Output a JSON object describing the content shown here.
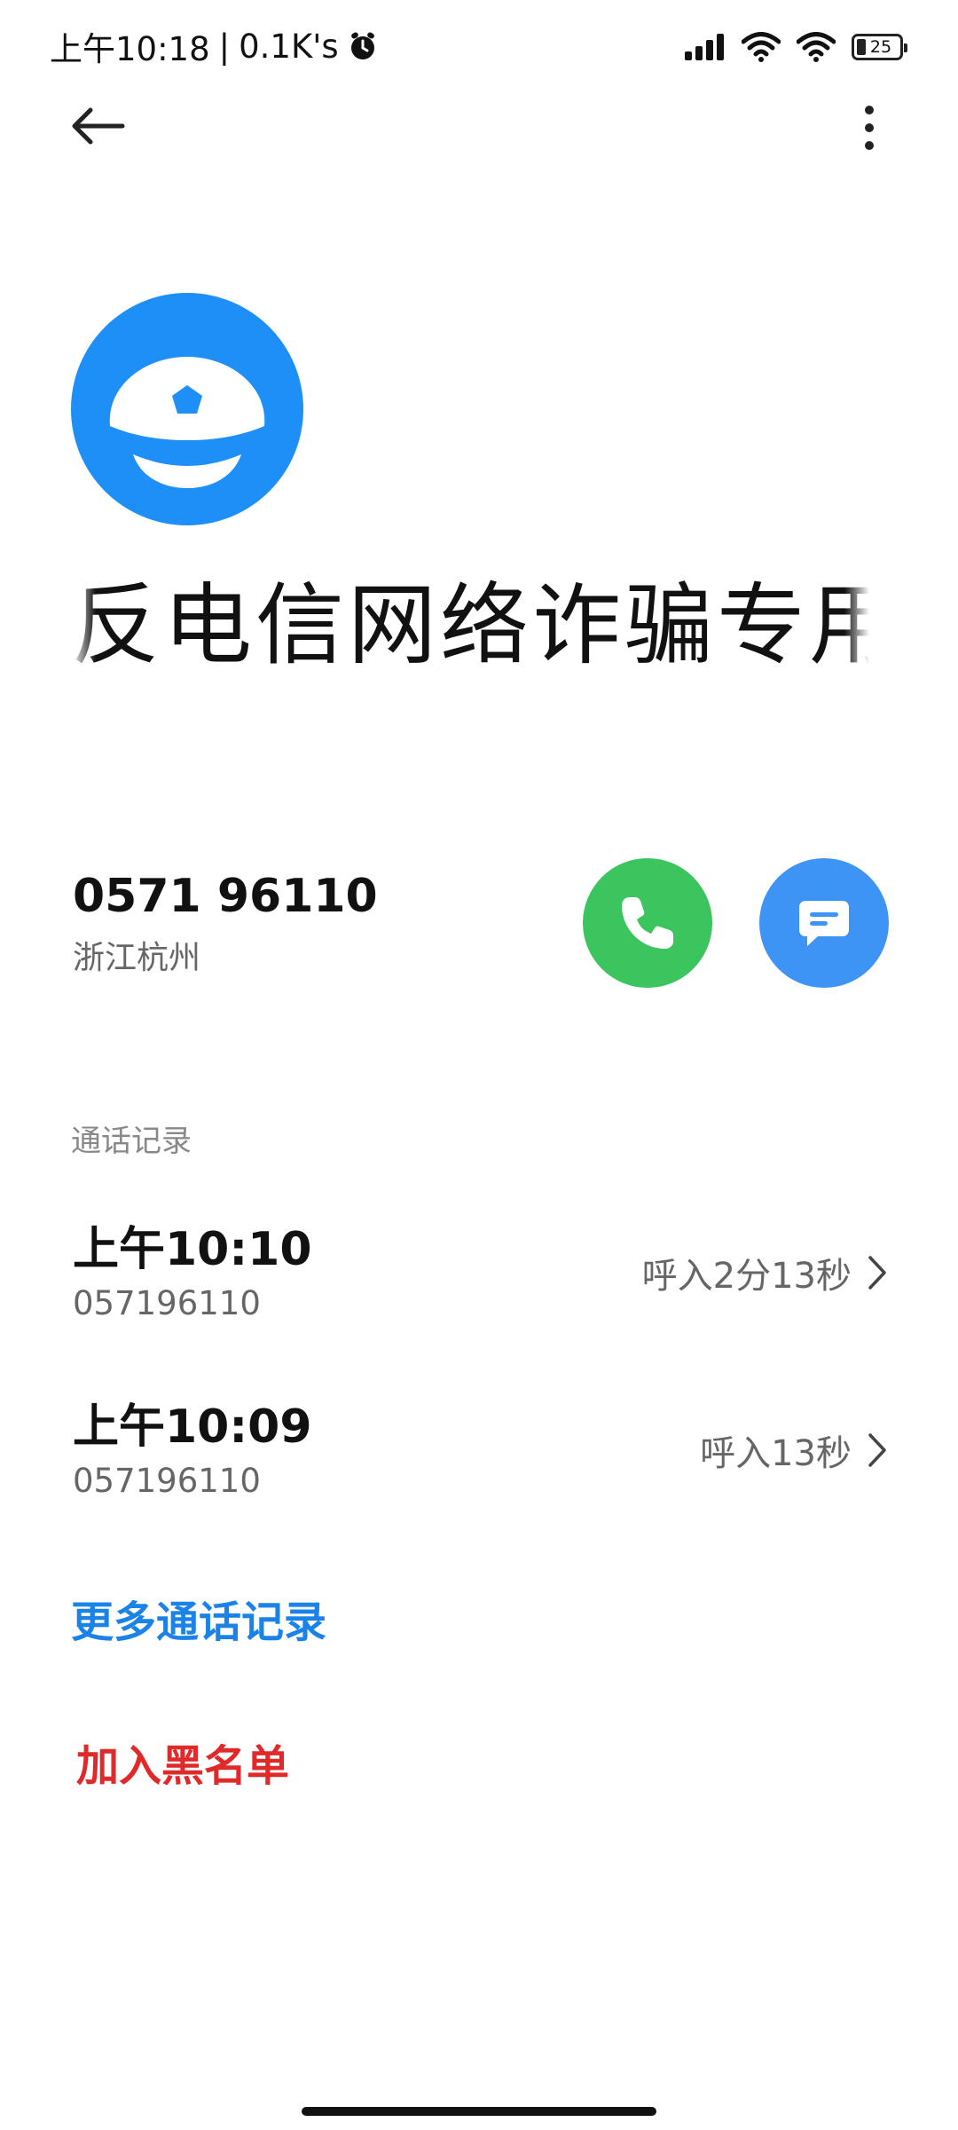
{
  "status_bar": {
    "time": "上午10:18",
    "separator": "|",
    "net_speed": "0.1K's",
    "battery_level": "25"
  },
  "contact": {
    "name": "反电信网络诈骗专用",
    "number": "0571 96110",
    "location": "浙江杭州"
  },
  "call_log": {
    "title": "通话记录",
    "items": [
      {
        "time": "上午10:10",
        "number": "057196110",
        "detail": "呼入2分13秒"
      },
      {
        "time": "上午10:09",
        "number": "057196110",
        "detail": "呼入13秒"
      }
    ]
  },
  "actions": {
    "more_calls": "更多通话记录",
    "add_blacklist": "加入黑名单"
  },
  "colors": {
    "avatar_bg": "#1f8ff8",
    "call_green": "#3cc45e",
    "message_blue": "#3e94f5",
    "link_blue": "#1b83e8",
    "danger_red": "#e02a2a"
  },
  "icons": {
    "back": "arrow-left-icon",
    "menu": "more-vertical-icon",
    "avatar": "police-cap-icon",
    "call": "phone-icon",
    "message": "chat-bubble-icon",
    "chevron": "chevron-right-icon",
    "alarm": "alarm-clock-icon",
    "signal": "cellular-signal-icon",
    "wifi": "wifi-icon",
    "battery": "battery-icon"
  }
}
